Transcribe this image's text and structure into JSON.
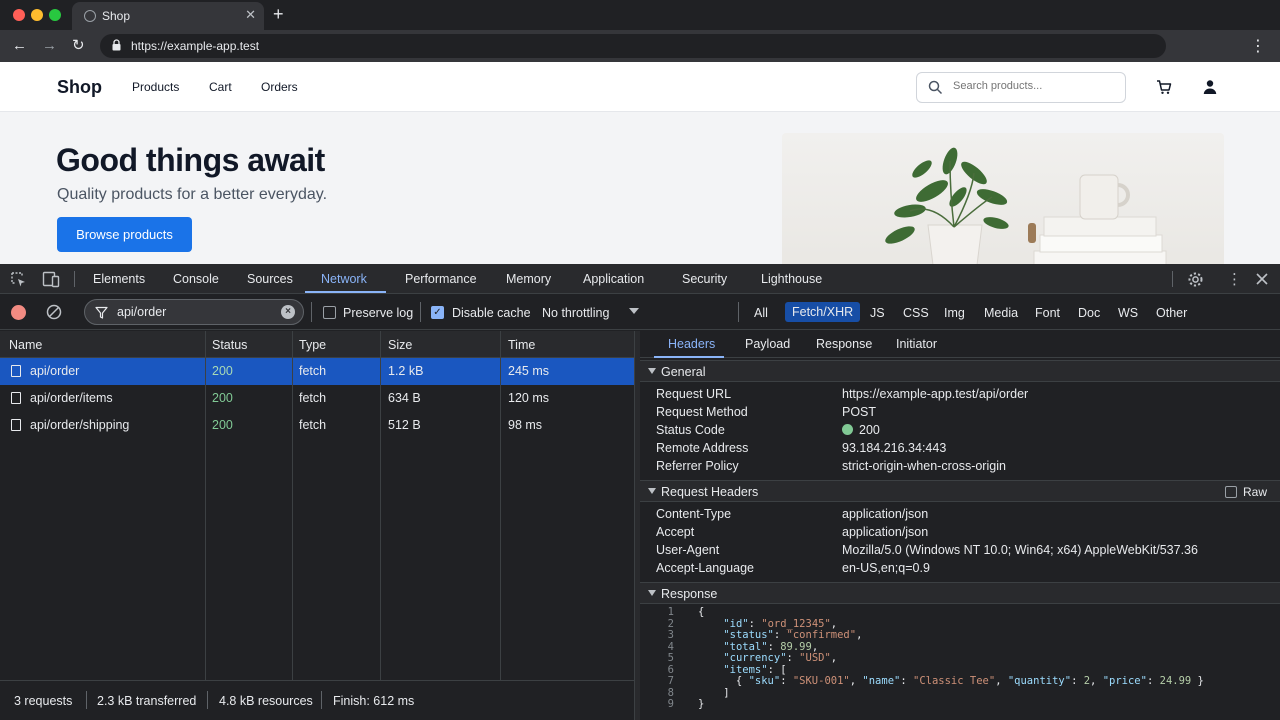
{
  "browser": {
    "tab_title": "Shop",
    "tab_close": "✕",
    "new_tab": "+",
    "url": "https://example-app.test",
    "back": "←",
    "forward": "→",
    "reload": "↻",
    "menu": "⋮"
  },
  "site": {
    "brand": "Shop",
    "nav": [
      "Products",
      "Cart",
      "Orders"
    ],
    "search_placeholder": "Search products...",
    "hero_title": "Good things await",
    "hero_subtitle": "Quality products for a better everyday.",
    "cta": "Browse products"
  },
  "devtools": {
    "tabs": [
      "Elements",
      "Console",
      "Sources",
      "Network",
      "Performance",
      "Memory",
      "Application",
      "Security",
      "Lighthouse"
    ],
    "active_tab": "Network",
    "filter_value": "api/order",
    "preserve_log": "Preserve log",
    "preserve_log_checked": false,
    "disable_cache": "Disable cache",
    "disable_cache_checked": true,
    "throttling": "No throttling",
    "type_filters": [
      "All",
      "Fetch/XHR",
      "JS",
      "CSS",
      "Img",
      "Media",
      "Font",
      "Doc",
      "WS",
      "Other"
    ],
    "active_type_filter": "Fetch/XHR",
    "columns": [
      "Name",
      "Status",
      "Type",
      "Size",
      "Time"
    ],
    "requests": [
      {
        "name": "api/order",
        "status": "200",
        "type": "fetch",
        "size": "1.2 kB",
        "time": "245 ms",
        "selected": true
      },
      {
        "name": "api/order/items",
        "status": "200",
        "type": "fetch",
        "size": "634 B",
        "time": "120 ms",
        "selected": false
      },
      {
        "name": "api/order/shipping",
        "status": "200",
        "type": "fetch",
        "size": "512 B",
        "time": "98 ms",
        "selected": false
      }
    ],
    "summary": {
      "requests": "3 requests",
      "transferred": "2.3 kB transferred",
      "resources": "4.8 kB resources",
      "finish": "Finish: 612 ms"
    },
    "detail_tabs": [
      "Headers",
      "Payload",
      "Response",
      "Initiator"
    ],
    "active_detail_tab": "Headers",
    "general": {
      "title": "General",
      "rows": [
        {
          "k": "Request URL",
          "v": "https://example-app.test/api/order"
        },
        {
          "k": "Request Method",
          "v": "POST"
        },
        {
          "k": "Status Code",
          "v": "200"
        },
        {
          "k": "Remote Address",
          "v": "93.184.216.34:443"
        },
        {
          "k": "Referrer Policy",
          "v": "strict-origin-when-cross-origin"
        }
      ]
    },
    "request_headers": {
      "title": "Request Headers",
      "raw_label": "Raw",
      "rows": [
        {
          "k": "Content-Type",
          "v": "application/json"
        },
        {
          "k": "Accept",
          "v": "application/json"
        },
        {
          "k": "User-Agent",
          "v": "Mozilla/5.0 (Windows NT 10.0; Win64; x64) AppleWebKit/537.36"
        },
        {
          "k": "Accept-Language",
          "v": "en-US,en;q=0.9"
        }
      ]
    },
    "response": {
      "title": "Response",
      "lines": [
        "{",
        "    \"id\": \"ord_12345\",",
        "    \"status\": \"confirmed\",",
        "    \"total\": 89.99,",
        "    \"currency\": \"USD\",",
        "    \"items\": [",
        "      { \"sku\": \"SKU-001\", \"name\": \"Classic Tee\", \"quantity\": 2, \"price\": 24.99 }",
        "    ]",
        "}"
      ]
    }
  },
  "colors": {
    "accent": "#1a73e8",
    "devtools_accent": "#8ab4f8",
    "status_ok": "#81c995",
    "selected_row": "#1a57c0"
  }
}
